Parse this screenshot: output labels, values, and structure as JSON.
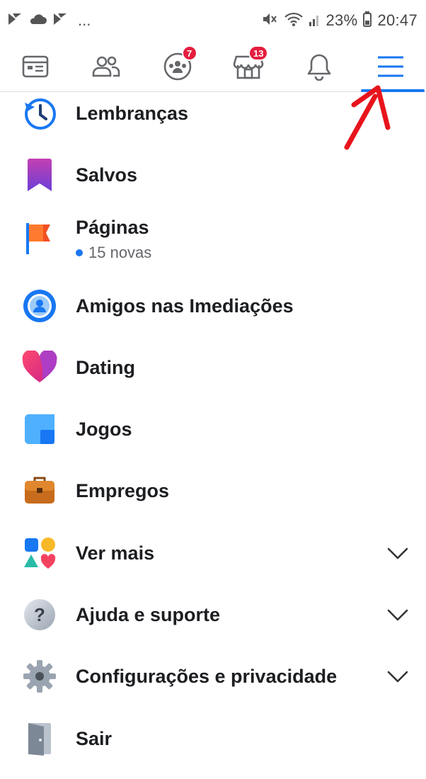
{
  "status_bar": {
    "battery": "23%",
    "time": "20:47",
    "overflow": "..."
  },
  "nav": {
    "tabs": [
      {
        "name": "feed",
        "icon": "newsfeed-icon",
        "badge": ""
      },
      {
        "name": "friends",
        "icon": "friends-icon",
        "badge": ""
      },
      {
        "name": "groups",
        "icon": "groups-icon",
        "badge": "7"
      },
      {
        "name": "marketplace",
        "icon": "marketplace-icon",
        "badge": "13"
      },
      {
        "name": "notifications",
        "icon": "bell-icon",
        "badge": ""
      },
      {
        "name": "menu",
        "icon": "hamburger-menu-icon",
        "badge": "",
        "active": true
      }
    ],
    "accent": "#1877f2",
    "badge_color": "#e41e3f"
  },
  "menu": {
    "items": [
      {
        "label": "Lembranças",
        "icon": "memories-clock-icon"
      },
      {
        "label": "Salvos",
        "icon": "saved-bookmark-icon"
      },
      {
        "label": "Páginas",
        "icon": "pages-flag-icon",
        "sub": "15 novas"
      },
      {
        "label": "Amigos nas Imediações",
        "icon": "nearby-friends-icon"
      },
      {
        "label": "Dating",
        "icon": "dating-heart-icon"
      },
      {
        "label": "Jogos",
        "icon": "games-icon"
      },
      {
        "label": "Empregos",
        "icon": "jobs-briefcase-icon"
      },
      {
        "label": "Ver mais",
        "icon": "see-more-shapes-icon",
        "expandable": true
      },
      {
        "label": "Ajuda e suporte",
        "icon": "help-question-icon",
        "expandable": true
      },
      {
        "label": "Configurações e privacidade",
        "icon": "settings-gear-icon",
        "expandable": true
      },
      {
        "label": "Sair",
        "icon": "logout-door-icon"
      }
    ]
  },
  "annotation_color": "#e8141c"
}
